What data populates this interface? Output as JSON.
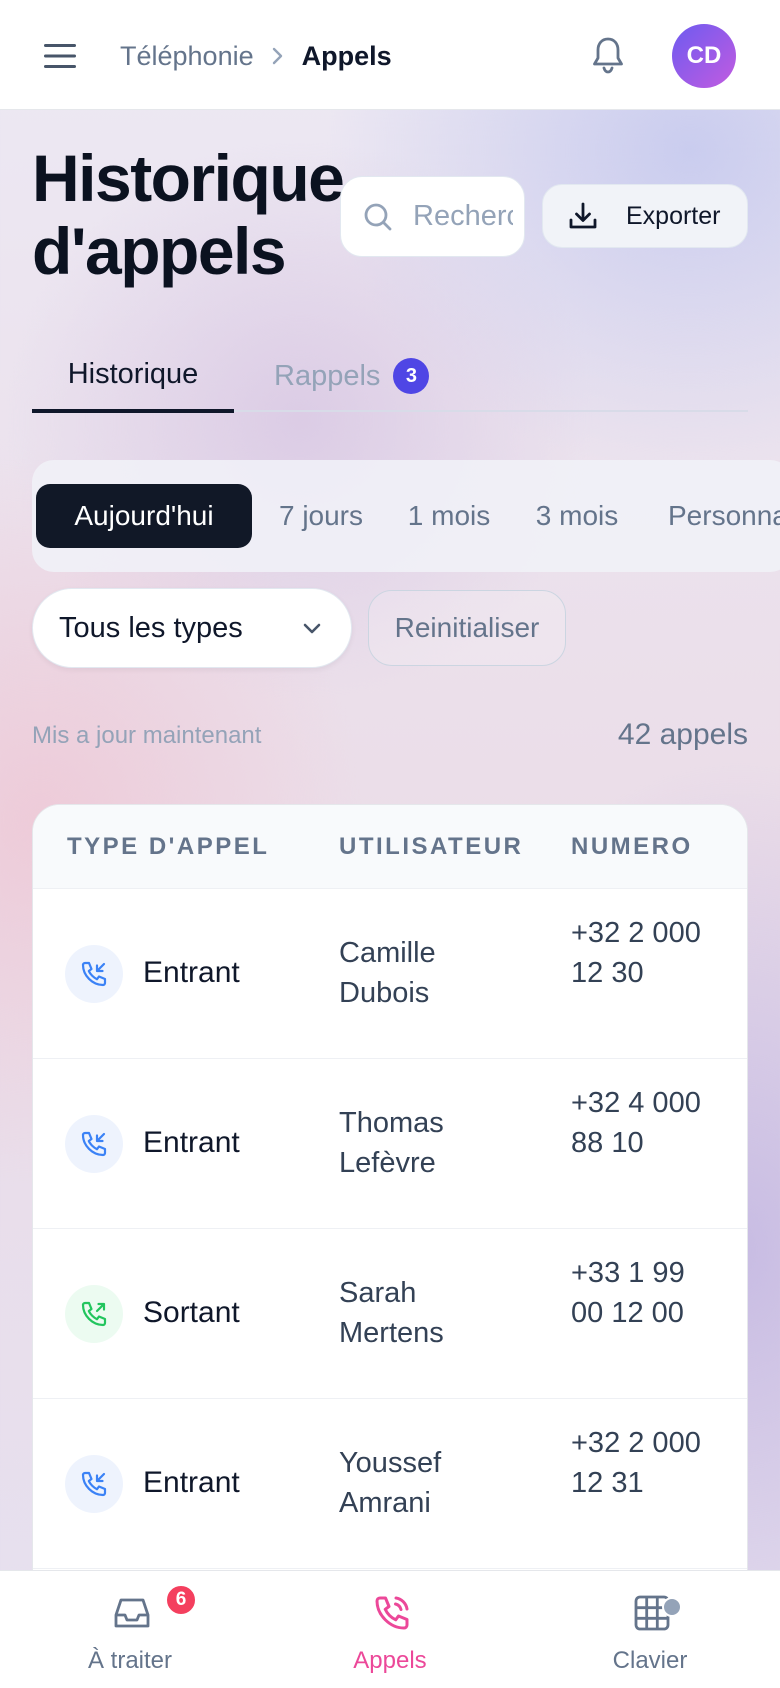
{
  "topbar": {
    "menu_icon": "menu-icon",
    "breadcrumb_parent": "Téléphonie",
    "breadcrumb_current": "Appels",
    "notification_icon": "bell-icon",
    "avatar_initials": "CD"
  },
  "header": {
    "title_line1": "Historique",
    "title_line2": "d'appels",
    "search_placeholder": "Rechercher",
    "export_label": "Exporter"
  },
  "tabs": [
    {
      "label": "Historique",
      "active": true
    },
    {
      "label": "Rappels",
      "badge": "3",
      "active": false
    }
  ],
  "range": {
    "options": [
      "Aujourd'hui",
      "7 jours",
      "1 mois",
      "3 mois",
      "Personnalisé"
    ],
    "selected": "Aujourd'hui"
  },
  "filters": {
    "type_select": "Tous les types",
    "reset_label": "Reinitialiser"
  },
  "status": {
    "updated": "Mis a jour maintenant",
    "count": "42 appels"
  },
  "table": {
    "headers": [
      "TYPE D'APPEL",
      "UTILISATEUR",
      "NUMERO"
    ],
    "rows": [
      {
        "type": "Entrant",
        "direction": "in",
        "user": "Camille Dubois",
        "number": "+32 2 000 12 30"
      },
      {
        "type": "Entrant",
        "direction": "in",
        "user": "Thomas Lefèvre",
        "number": "+32 4 000 88 10"
      },
      {
        "type": "Sortant",
        "direction": "out",
        "user": "Sarah Mertens",
        "number": "+33 1 99 00 12 00"
      },
      {
        "type": "Entrant",
        "direction": "in",
        "user": "Youssef Amrani",
        "number": "+32 2 000 12 31"
      }
    ]
  },
  "bottom_nav": [
    {
      "label": "À traiter",
      "icon": "inbox-icon",
      "badge": "6"
    },
    {
      "label": "Appels",
      "icon": "phone-icon",
      "active": true
    },
    {
      "label": "Clavier",
      "icon": "keypad-icon",
      "dot": true
    }
  ],
  "colors": {
    "accent": "#4f46e5",
    "active_nav": "#ec4899",
    "incoming": "#3b82f6",
    "outgoing": "#22c55e",
    "dark": "#111827"
  }
}
